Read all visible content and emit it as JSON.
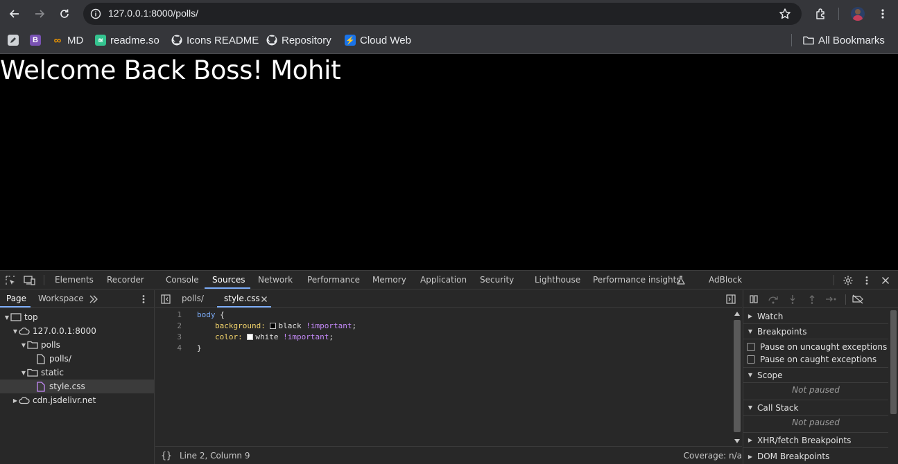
{
  "browser": {
    "url": "127.0.0.1:8000/polls/",
    "bookmarks": [
      {
        "label": "",
        "icon": "edit-icon"
      },
      {
        "label": "",
        "icon": "bootstrap-icon"
      },
      {
        "label": "MD",
        "icon": "infinity-icon"
      },
      {
        "label": "readme.so",
        "icon": "readme-icon"
      },
      {
        "label": "Icons README",
        "icon": "github-icon"
      },
      {
        "label": "Repository",
        "icon": "github-icon"
      },
      {
        "label": "Cloud Web",
        "icon": "bolt-icon"
      }
    ],
    "all_bookmarks": "All Bookmarks"
  },
  "page": {
    "heading": "Welcome Back Boss! Mohit"
  },
  "devtools": {
    "tabs": [
      "Elements",
      "Recorder",
      "Console",
      "Sources",
      "Network",
      "Performance",
      "Memory",
      "Application",
      "Security",
      "Lighthouse",
      "Performance insights",
      "AdBlock"
    ],
    "active_tab": "Sources",
    "navigator": {
      "tabs": [
        "Page",
        "Workspace"
      ],
      "active_tab": "Page",
      "tree": [
        {
          "label": "top",
          "type": "frame"
        },
        {
          "label": "127.0.0.1:8000",
          "type": "cloud"
        },
        {
          "label": "polls",
          "type": "folder"
        },
        {
          "label": "polls/",
          "type": "file"
        },
        {
          "label": "static",
          "type": "folder"
        },
        {
          "label": "style.css",
          "type": "css",
          "selected": true
        },
        {
          "label": "cdn.jsdelivr.net",
          "type": "cloud"
        }
      ]
    },
    "editor": {
      "tabs": [
        "polls/",
        "style.css"
      ],
      "active_tab": "style.css",
      "line_numbers": [
        "1",
        "2",
        "3",
        "4"
      ],
      "code": {
        "selector": "body",
        "open_brace": " {",
        "prop1": "background:",
        "val1": "black",
        "prop2": "color:",
        "val2": "white",
        "important": "!important",
        "semicolon": ";",
        "close_brace": "}"
      },
      "status_position": "Line 2, Column 9",
      "coverage": "Coverage: n/a"
    },
    "debugger": {
      "watch": "Watch",
      "breakpoints": "Breakpoints",
      "pause_uncaught": "Pause on uncaught exceptions",
      "pause_caught": "Pause on caught exceptions",
      "scope": "Scope",
      "not_paused": "Not paused",
      "call_stack": "Call Stack",
      "xhr_breakpoints": "XHR/fetch Breakpoints",
      "dom_breakpoints": "DOM Breakpoints"
    },
    "colors": {
      "accent": "#7cacf8",
      "selector": "#7cacf8",
      "property": "#f5d66c",
      "important": "#c58af9"
    }
  }
}
